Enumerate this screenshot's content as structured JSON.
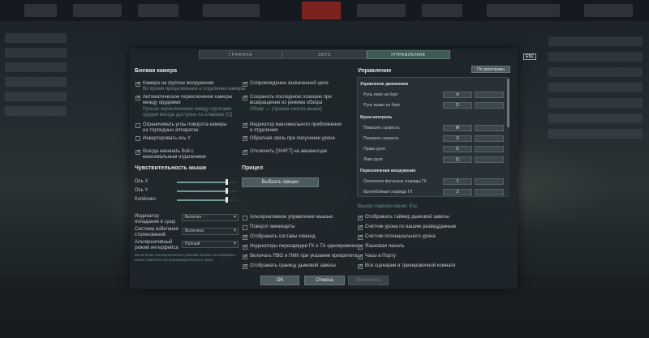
{
  "tabs": [
    "ГРАФИКА",
    "ЗВУК",
    "УПРАВЛЕНИЕ"
  ],
  "esc_badge": "ESC",
  "camera": {
    "header": "Боевая камера",
    "col1": [
      {
        "label": "Камера на группах вооружения",
        "sub": "Во время прицеливания и отделения камеры",
        "checked": true
      },
      {
        "label": "Автоматическое переключение камеры между орудиями",
        "sub": "Ручное переключение между группами орудия всегда доступно по клавише [C]",
        "checked": true
      },
      {
        "label": "Ограничивать углы поворота камеры на торпедных аппаратах",
        "checked": false
      },
      {
        "label": "Инвертировать ось Y",
        "checked": false
      },
      {
        "label": "Всегда начинать бой с максимальным отдалением",
        "checked": true
      }
    ],
    "col2": [
      {
        "label": "Сопровождение захваченной цели",
        "checked": true
      },
      {
        "label": "Сохранять последнюю позицию при возвращении из режима обзора",
        "sub": "Обзор — (правая кнопка мыши)",
        "checked": true
      },
      {
        "label": "Индикатор максимального приближения и отдаления",
        "checked": true
      },
      {
        "label": "Обратная связь при получении урона",
        "checked": true
      },
      {
        "label": "Отключить [SHIFT] на авианосцах",
        "checked": true
      }
    ]
  },
  "mouse": {
    "header": "Чувствительность мыши",
    "sliders": [
      {
        "label": "Ось X",
        "value": 0.82
      },
      {
        "label": "Ось Y",
        "value": 0.82
      },
      {
        "label": "Колёсико",
        "value": 0.82
      }
    ]
  },
  "crosshair": {
    "header": "Прицел",
    "button": "Выбрать прицел"
  },
  "dropdowns": [
    {
      "label": "Индикатор попадания в сушу",
      "value": "Включён"
    },
    {
      "label": "Система избегания столкновений",
      "value": "Включена"
    },
    {
      "label": "Альтернативный режим интерфейса",
      "value": "Полный"
    }
  ],
  "dropdown_note": "Включение альтернативного режима боевого интерфейса может повлиять на производительность игры",
  "mid_checks": [
    {
      "label": "Альтернативное управление мышью",
      "checked": false
    },
    {
      "label": "Поворот миникарты",
      "checked": false
    },
    {
      "label": "Отображать составы команд",
      "checked": true
    },
    {
      "label": "Индикаторы перезарядки ГК и ТА одновременно",
      "checked": true
    },
    {
      "label": "Включать ПВО и ПМК при указании приоритета",
      "checked": true
    },
    {
      "label": "Отображать границу дымовой завесы",
      "checked": true
    }
  ],
  "controls": {
    "header": "Управление",
    "default_button": "По умолчанию",
    "groups": [
      {
        "title": "Управление движением",
        "rows": [
          {
            "label": "Руль лево на борт",
            "key": "A"
          },
          {
            "label": "Руль право на борт",
            "key": "D"
          }
        ]
      },
      {
        "title": "Круиз-контроль",
        "rows": [
          {
            "label": "Повысить скорость",
            "key": "W"
          },
          {
            "label": "Понизить скорость",
            "key": "S"
          },
          {
            "label": "Право руля",
            "key": "E"
          },
          {
            "label": "Лево руля",
            "key": "Q"
          }
        ]
      },
      {
        "title": "Переключение вооружения",
        "rows": [
          {
            "label": "Осколочно-фугасные снаряды ГК",
            "key": "1"
          },
          {
            "label": "Бронебойные снаряды ГК",
            "key": "2"
          }
        ]
      }
    ]
  },
  "menu_key": "Вызов главного меню: Esc",
  "right_checks": [
    {
      "label": "Отображать таймер дымовой завесы",
      "checked": true
    },
    {
      "label": "Счётчик урона по вашим разведданным",
      "checked": true
    },
    {
      "label": "Счётчик потенциального урона",
      "checked": true
    },
    {
      "label": "Языковая панель",
      "checked": true
    },
    {
      "label": "Часы в Порту",
      "checked": true
    },
    {
      "label": "Все сценарии в тренировочной комнате",
      "checked": true
    }
  ],
  "buttons": {
    "ok": "ОК",
    "cancel": "Отмена",
    "apply": "Применить"
  }
}
